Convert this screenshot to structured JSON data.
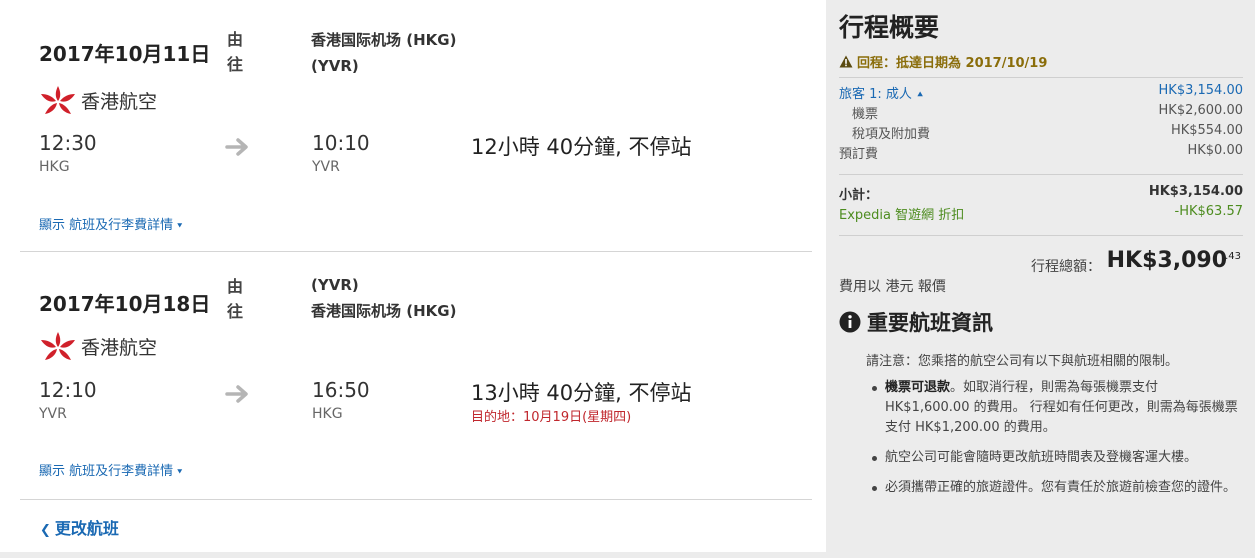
{
  "legs": [
    {
      "date": "2017年10月11日",
      "airline": "香港航空",
      "via_label": "由往",
      "route_line1": "香港国际机场 (HKG)",
      "route_line2": "(YVR)",
      "depart_time": "12:30",
      "depart_code": "HKG",
      "arrive_time": "10:10",
      "arrive_code": "YVR",
      "duration": "12小時 40分鐘, 不停站",
      "dest_note": "",
      "details_link": "顯示 航班及行李費詳情"
    },
    {
      "date": "2017年10月18日",
      "airline": "香港航空",
      "via_label": "由往",
      "route_line1": "(YVR)",
      "route_line2": "香港国际机场 (HKG)",
      "depart_time": "12:10",
      "depart_code": "YVR",
      "arrive_time": "16:50",
      "arrive_code": "HKG",
      "duration": "13小時 40分鐘, 不停站",
      "dest_note": "目的地：10月19日(星期四)",
      "details_link": "顯示 航班及行李費詳情"
    }
  ],
  "change_flight": "更改航班",
  "summary": {
    "title": "行程概要",
    "warning": "回程：抵達日期為 2017/10/19",
    "traveler_label": "旅客 1: 成人",
    "traveler_total": "HK$3,154.00",
    "ticket_label": "機票",
    "ticket_value": "HK$2,600.00",
    "tax_label": "稅項及附加費",
    "tax_value": "HK$554.00",
    "booking_fee_label": "預訂費",
    "booking_fee_value": "HK$0.00",
    "subtotal_label": "小計：",
    "subtotal_value": "HK$3,154.00",
    "discount_label": "Expedia 智遊網 折扣",
    "discount_value": "-HK$63.57",
    "total_label": "行程總額：",
    "total_value": "HK$3,090",
    "total_cents": ".43",
    "currency_note": "費用以 港元 報價"
  },
  "info": {
    "title": "重要航班資訊",
    "notice": "請注意：您乘搭的航空公司有以下與航班相關的限制。",
    "bullet1_bold": "機票可退款",
    "bullet1_text": "。如取消行程，則需為每張機票支付 HK$1,600.00 的費用。 行程如有任何更改，則需為每張機票支付 HK$1,200.00 的費用。",
    "bullet2": "航空公司可能會隨時更改航班時間表及登機客運大樓。",
    "bullet3": "必須攜帶正確的旅遊證件。您有責任於旅遊前檢查您的證件。"
  },
  "colors": {
    "link": "#1a69b3",
    "warning": "#8a6d0a",
    "discount": "#4d8c1f",
    "dest_note": "#c0272d",
    "airline_logo": "#d0202a"
  }
}
